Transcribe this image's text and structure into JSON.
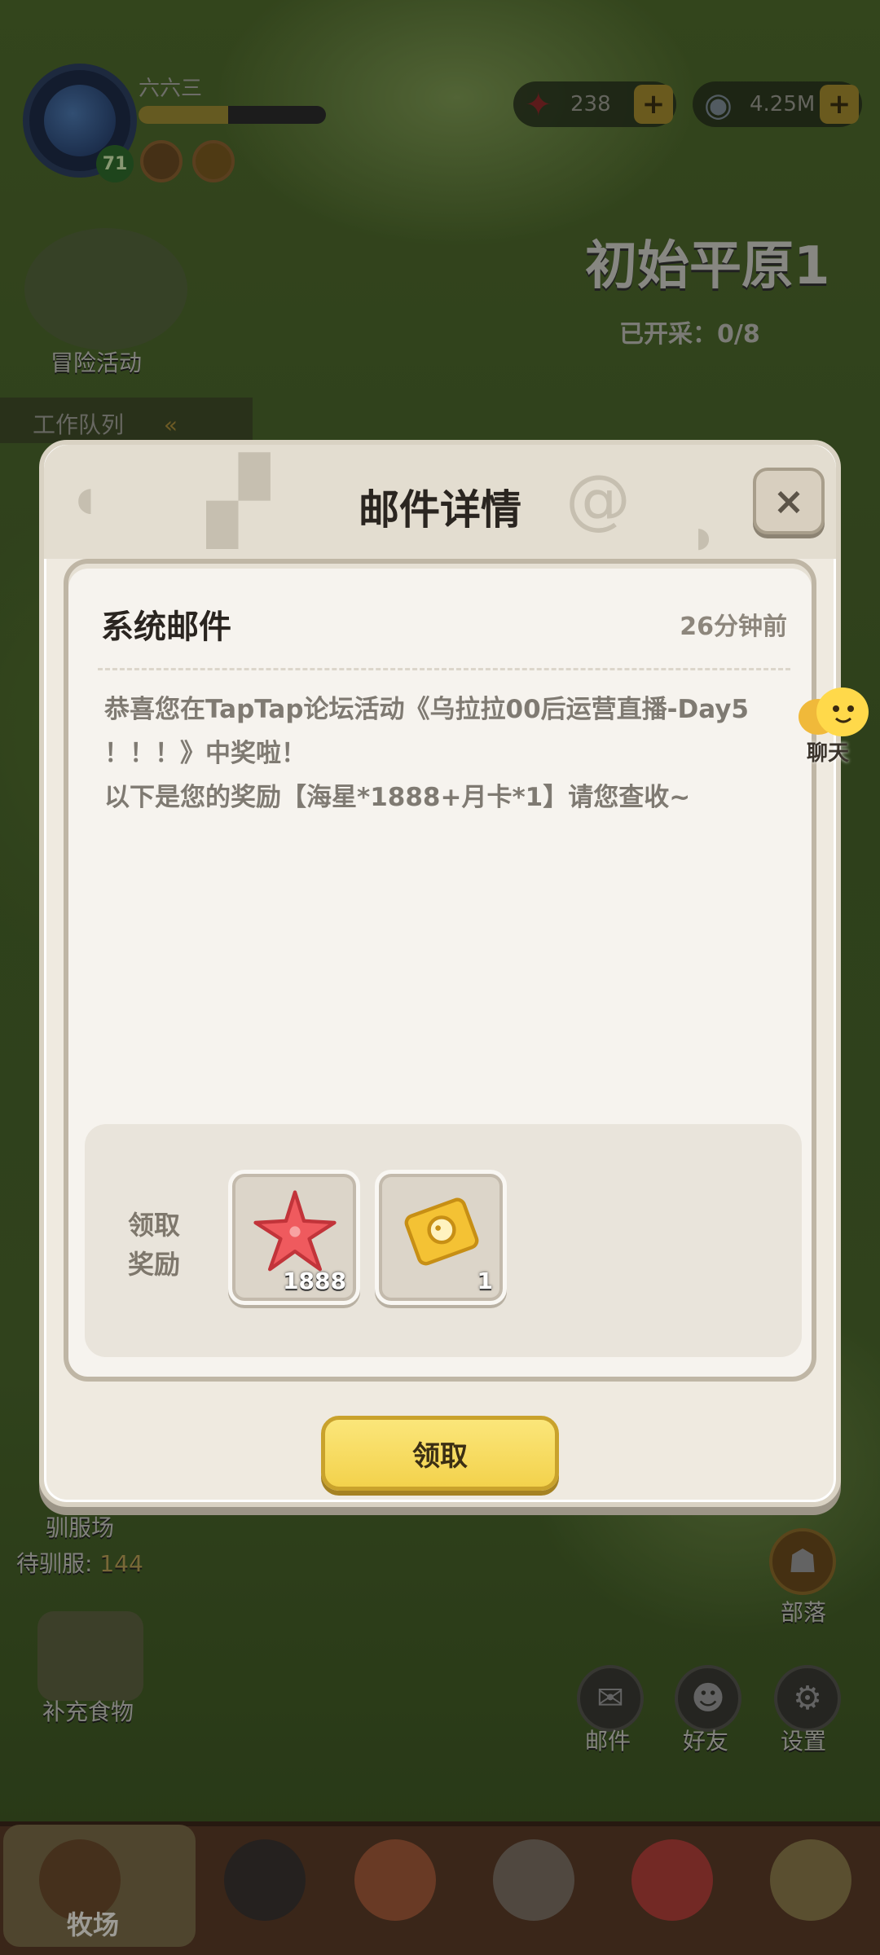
{
  "hud": {
    "player_name": "六六三",
    "level": "71",
    "exp_progress": 0.48,
    "currencies": [
      {
        "icon": "starfish-icon",
        "value": "238",
        "plus": "+"
      },
      {
        "icon": "shell-icon",
        "value": "4.25M",
        "plus": "+"
      }
    ]
  },
  "area": {
    "title": "初始平原1",
    "mined": "已开采：0/8"
  },
  "left_panel": {
    "adventure_label": "冒险活动",
    "queue_label": "工作队列",
    "tame_label": "驯服场",
    "tame_pending": "待驯服:",
    "tame_count": "144",
    "food_label": "补充食物"
  },
  "right_panel": {
    "tribe_label": "部落",
    "mail_label": "邮件",
    "friends_label": "好友",
    "settings_label": "设置"
  },
  "bottom_nav": {
    "items": [
      {
        "label": "牧场"
      }
    ]
  },
  "chat": {
    "label": "聊天"
  },
  "dialog": {
    "title": "邮件详情",
    "close": "×",
    "sender": "系统邮件",
    "time": "26分钟前",
    "body_line1": "恭喜您在TapTap论坛活动《乌拉拉00后运营直播-Day5",
    "body_line2": "！！！》中奖啦！",
    "body_line3": "以下是您的奖励【海星*1888+月卡*1】请您查收~",
    "reward_label_1": "领取",
    "reward_label_2": "奖励",
    "rewards": [
      {
        "icon": "starfish-icon",
        "count": "1888"
      },
      {
        "icon": "gold-card-icon",
        "count": "1"
      }
    ],
    "claim_button": "领取"
  },
  "colors": {
    "accent_yellow": "#f3d24c",
    "dialog_bg": "#efeae0",
    "text_dark": "#2a2520",
    "text_muted": "#7f7a72"
  }
}
